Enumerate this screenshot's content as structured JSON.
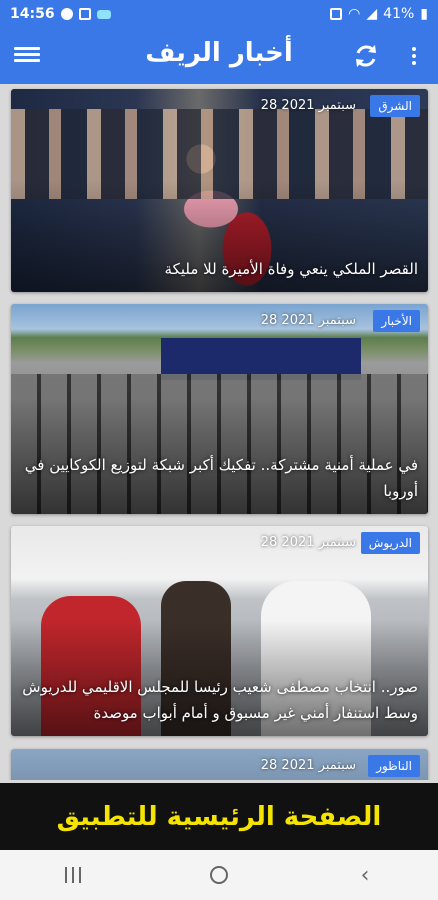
{
  "status_bar": {
    "time": "14:56",
    "battery": "41%"
  },
  "app_bar": {
    "title": "أخبار الريف"
  },
  "articles": [
    {
      "category": "الشرق",
      "date": "28 سبتمبر 2021",
      "headline": "القصر الملكي ينعي وفاة الأميرة للا مليكة"
    },
    {
      "category": "الأخبار",
      "date": "28 سبتمبر 2021",
      "headline": "في عملية أمنية مشتركة.. تفكيك أكبر شبكة لتوزيع الكوكايين في أوروبا"
    },
    {
      "category": "الدريوش",
      "date": "28 سبتمبر 2021",
      "headline": "صور.. انتخاب مصطفى شعيب رئيسا للمجلس الاقليمي للدريوش وسط استنفار أمني غير مسبوق و أمام أبواب موصدة"
    },
    {
      "category": "الناظور",
      "date": "28 سبتمبر 2021",
      "headline": ""
    }
  ],
  "banner": {
    "text": "الصفحة الرئيسية للتطبيق"
  },
  "colors": {
    "primary": "#3a78e8",
    "banner_bg": "#111111",
    "banner_text": "#f5e400"
  }
}
